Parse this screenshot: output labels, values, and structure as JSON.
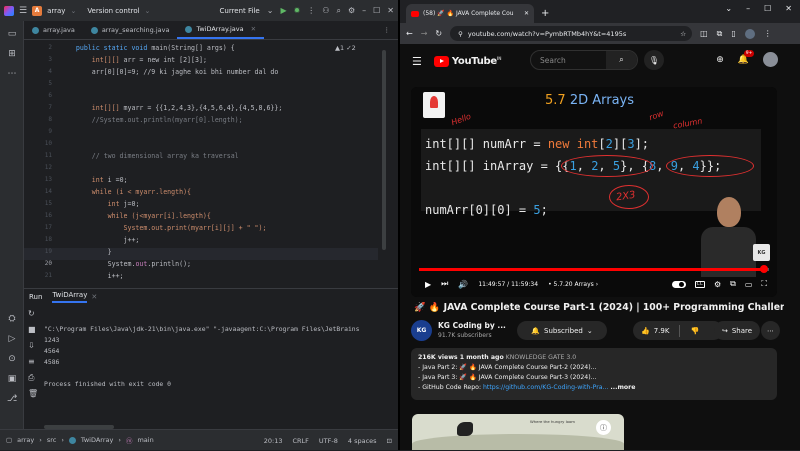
{
  "ide": {
    "project_badge": "A",
    "project_name": "array",
    "vcs": "Version control",
    "run_config": "Current File",
    "tabs": [
      {
        "label": "array.java"
      },
      {
        "label": "array_searching.java"
      },
      {
        "label": "TwiDArray.java"
      }
    ],
    "warnings": "▲1 ✓2",
    "line_numbers": [
      "2",
      "3",
      "4",
      "5",
      "6",
      "7",
      "8",
      "9",
      "10",
      "11",
      "12",
      "13",
      "14",
      "15",
      "16",
      "17",
      "18",
      "19",
      "20",
      "21"
    ],
    "code_lines": [
      [
        "    ",
        "public static void ",
        "main",
        "(String[] args) {"
      ],
      [
        "        int[][] ",
        "arr",
        " = new int [2][3];",
        ""
      ],
      [
        "        arr[0][0]=9; //9 ki jaghe koi bhi number dal do",
        "",
        "",
        ""
      ],
      [
        "",
        "",
        "",
        ""
      ],
      [
        "",
        "",
        "",
        ""
      ],
      [
        "        int[][] ",
        "myarr",
        " = {{1,2,4,3},{4,5,6,4},{4,5,8,6}};",
        ""
      ],
      [
        "        //System.out.println(myarr[0].length);",
        "",
        "",
        ""
      ],
      [
        "",
        "",
        "",
        ""
      ],
      [
        "",
        "",
        "",
        ""
      ],
      [
        "        // two dimensional array ka traversal",
        "",
        "",
        ""
      ],
      [
        "",
        "",
        "",
        ""
      ],
      [
        "        int ",
        "i",
        " =0;",
        ""
      ],
      [
        "        while (i < myarr.length){",
        "",
        "",
        ""
      ],
      [
        "            int ",
        "j",
        "=0;",
        ""
      ],
      [
        "            while (j<myarr[i].length){",
        "",
        "",
        ""
      ],
      [
        "                System.out.print(myarr[i][j] + \" \");",
        "",
        "",
        ""
      ],
      [
        "                j++;",
        "",
        "",
        ""
      ],
      [
        "            }",
        "",
        "",
        ""
      ],
      [
        "            System.",
        "out",
        ".println();",
        ""
      ],
      [
        "            i++;",
        "",
        "",
        ""
      ]
    ],
    "run_label": "Run",
    "run_tab": "TwiDArray",
    "console": [
      "\"C:\\Program Files\\Java\\jdk-21\\bin\\java.exe\" \"-javaagent:C:\\Program Files\\JetBrains",
      "1243",
      "4564",
      "4586",
      "",
      "Process finished with exit code 0"
    ],
    "breadcrumb": [
      "array",
      "src",
      "TwiDArray",
      "main"
    ],
    "status": {
      "position": "20:13",
      "line_sep": "CRLF",
      "encoding": "UTF-8",
      "indent": "4 spaces"
    }
  },
  "browser": {
    "tab_title": "(58) 🚀 🔥 JAVA Complete Cou",
    "url": "youtube.com/watch?v=PymbRTMb4hY&t=4195s",
    "search_placeholder": "Search",
    "notif_count": "9+",
    "slide": {
      "title_num": "5.7",
      "title_text": " 2D Arrays",
      "line1_a": "int[][] numArr = ",
      "line1_b": "new int",
      "line1_c": "[",
      "line1_d": "2",
      "line1_e": "][",
      "line1_f": "3",
      "line1_g": "];",
      "line2_a": "int[][] inArray = {{",
      "line2_b": "1",
      "line2_c": ", ",
      "line2_d": "2",
      "line2_e": ", ",
      "line2_f": "5",
      "line2_g": "}, {",
      "line2_h": "8",
      "line2_i": ", ",
      "line2_j": "9",
      "line2_k": ", ",
      "line2_l": "4",
      "line2_m": "}};",
      "line3_a": "numArr[0][0] = ",
      "line3_b": "5",
      "line3_c": ";",
      "hand_hello": "Hello",
      "hand_row": "row",
      "hand_column": "column",
      "hand_2x3": "2X3",
      "kg_badge": "KG"
    },
    "player": {
      "time": "11:49:57 / 11:59:34",
      "chapter": "• 5.7.20 Arrays ›",
      "progress": 0.986
    },
    "video_title": "🚀 🔥 JAVA Complete Course Part-1 (2024) | 100+ Programming Challenges",
    "channel": {
      "avatar": "KG",
      "name": "KG Coding by ...",
      "subs": "91.7K subscribers"
    },
    "subscribed": "Subscribed",
    "likes": "7.9K",
    "share": "Share",
    "desc": {
      "meta": "216K views  1 month ago",
      "tag": " KNOWLEDGE GATE 3.0",
      "p2_label": "- Java Part 2: ",
      "p2_link": "🚀 🔥 JAVA Complete Course Part-2 (2024)...",
      "p3_label": "- Java Part 3: ",
      "p3_link": "🚀 🔥 JAVA Complete Course Part-3 (2024)...",
      "gh_label": "- GitHub Code Repo: ",
      "gh_link": "https://github.com/KG-Coding-with-Pra...",
      "more": "...more"
    },
    "ad": {
      "text": "Where the hungry loom"
    },
    "colors": {
      "accent": "#3574f0",
      "yt_red": "#ff0000",
      "link": "#3ea6ff"
    }
  }
}
